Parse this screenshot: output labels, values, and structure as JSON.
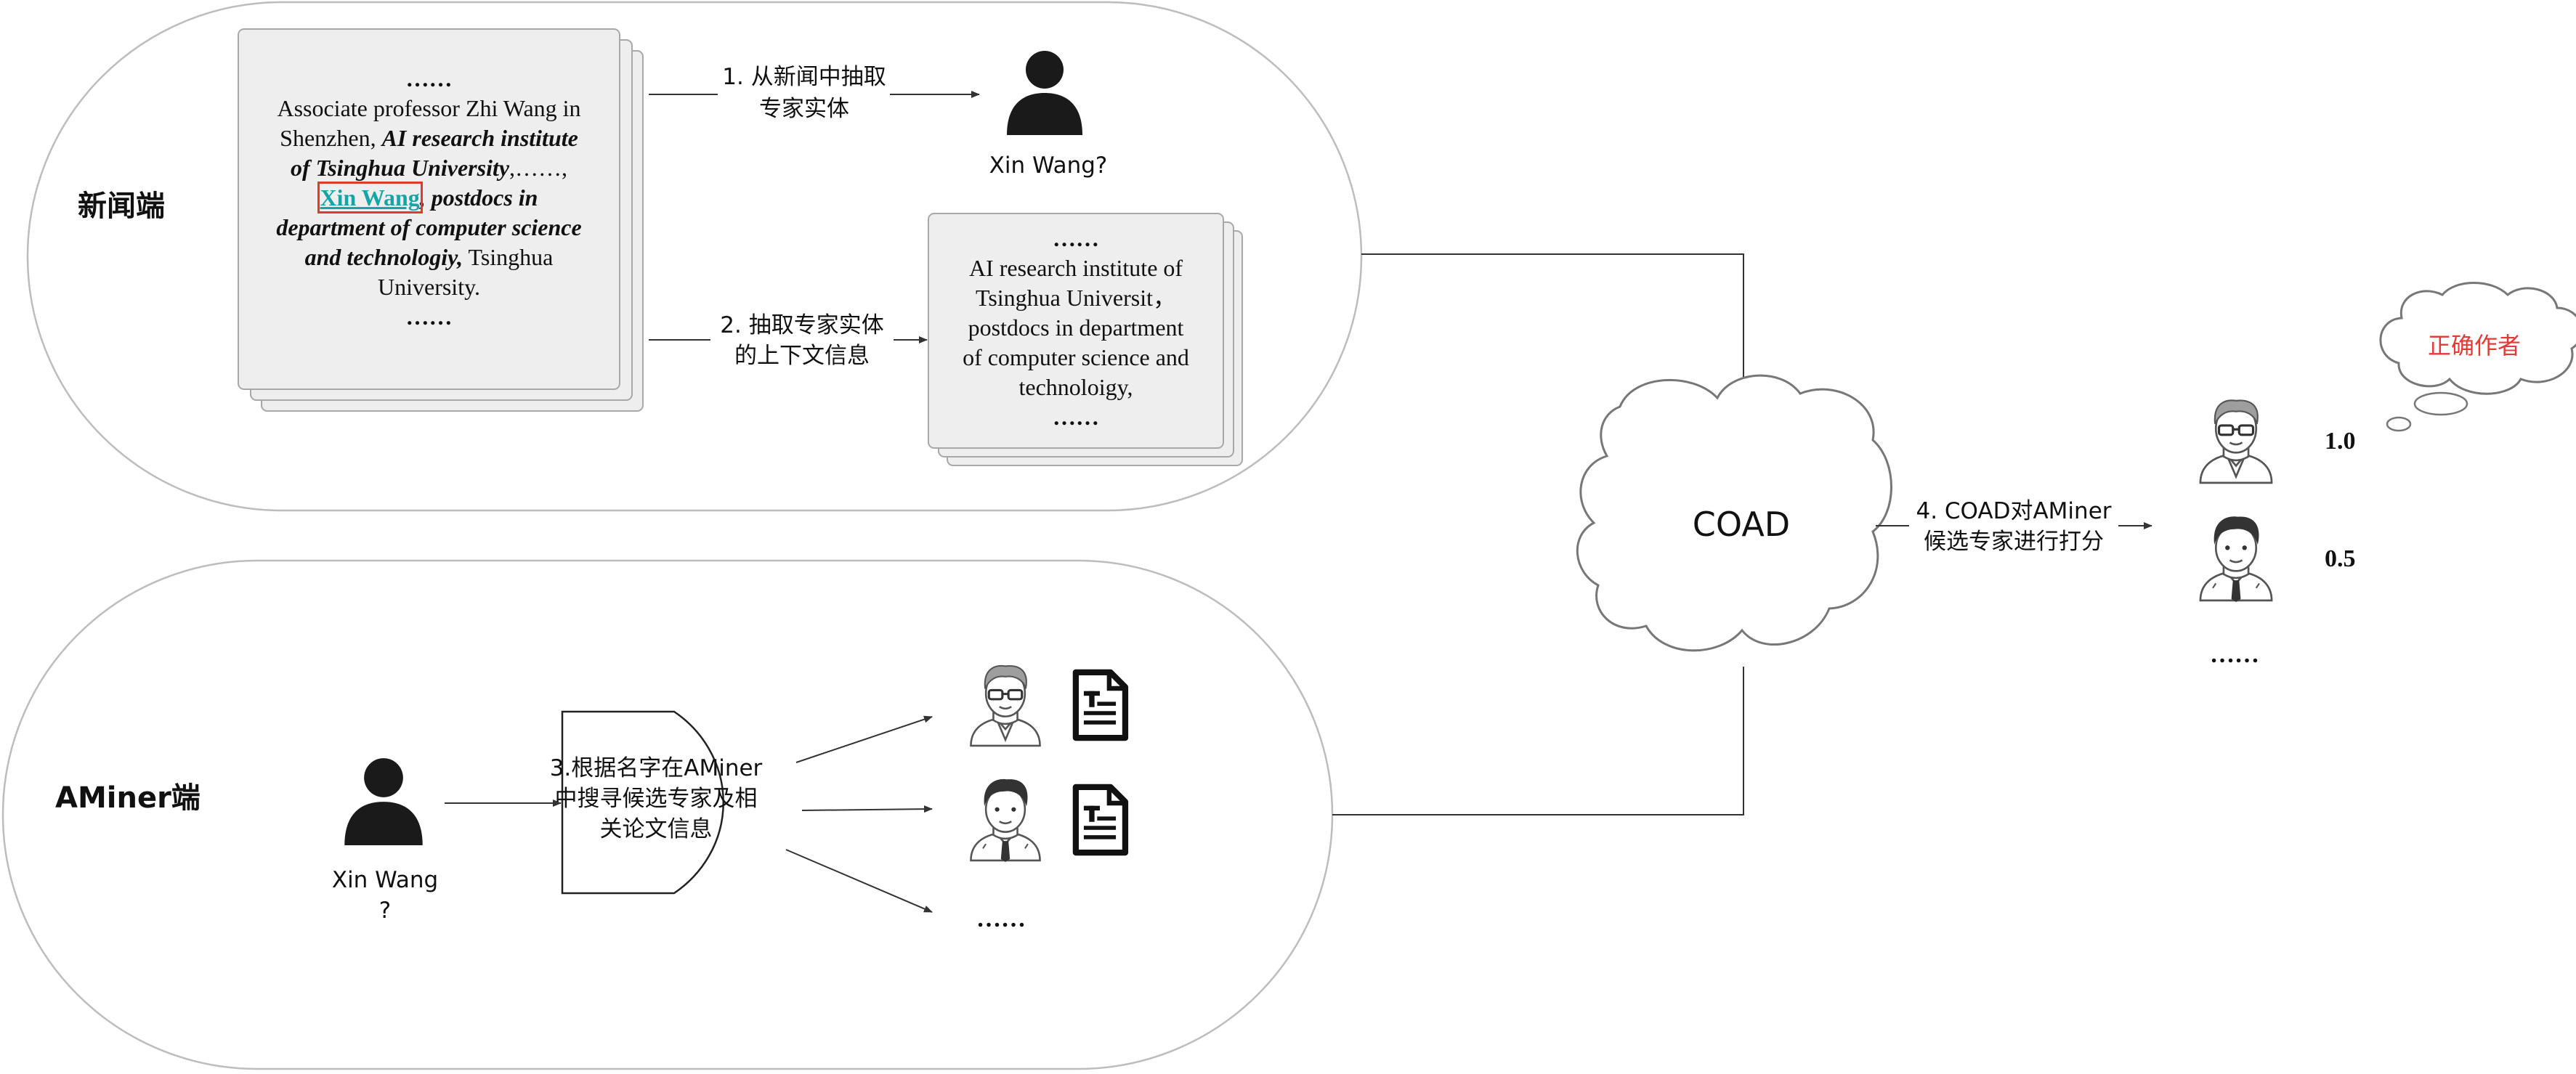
{
  "colors": {
    "panel_stroke": "#bdbdbd",
    "doc_fill": "#eeeeee",
    "doc_stroke": "#a8a8a8",
    "line": "#333333",
    "highlight_name": "#14a6a6",
    "highlight_box": "#e03a2f",
    "correct_author": "#e53935",
    "person": "#1a1a1a"
  },
  "news": {
    "title": "新闻端",
    "doc1": {
      "top_dots": "……",
      "line1": "Associate professor Zhi Wang  in",
      "line2_plain": "Shenzhen, ",
      "line2_bi": "AI research institute",
      "line3_bi": "of Tsinghua University",
      "line3_tail": ",……,",
      "line4_name": "Xin Wang",
      "line4_bi": ", postdocs in",
      "line5_bi": "department of computer science",
      "line6_bi": "and technologiy,",
      "line6_plain": " Tsinghua",
      "line7": "University.",
      "bottom_dots": "……"
    },
    "step1": {
      "line1": "1. 从新闻中抽取",
      "line2": "专家实体"
    },
    "step2": {
      "line1": "2. 抽取专家实体",
      "line2": "的上下文信息"
    },
    "person_label": "Xin Wang?",
    "doc2": {
      "top_dots": "……",
      "line1": "AI research institute of",
      "line2": "Tsinghua Universit，",
      "line3": "postdocs in department",
      "line4": "of computer science and",
      "line5": "technoloigy,",
      "bottom_dots": "……"
    }
  },
  "aminer": {
    "title": "AMiner端",
    "person_label_line1": "Xin Wang",
    "person_label_line2": "?",
    "step3": {
      "line1": "3.根据名字在AMiner",
      "line2": "中搜寻候选专家及相",
      "line3": "关论文信息"
    },
    "ellipsis": "……",
    "icons": [
      "expert-glasses-icon",
      "expert-tie-icon",
      "paper-document-icon"
    ]
  },
  "coad": {
    "label": "COAD",
    "step4": {
      "line1": "4. COAD对AMiner",
      "line2": "候选专家进行打分"
    }
  },
  "results": {
    "scores": [
      "1.0",
      "0.5"
    ],
    "ellipsis": "……",
    "correct_author": "正确作者"
  }
}
